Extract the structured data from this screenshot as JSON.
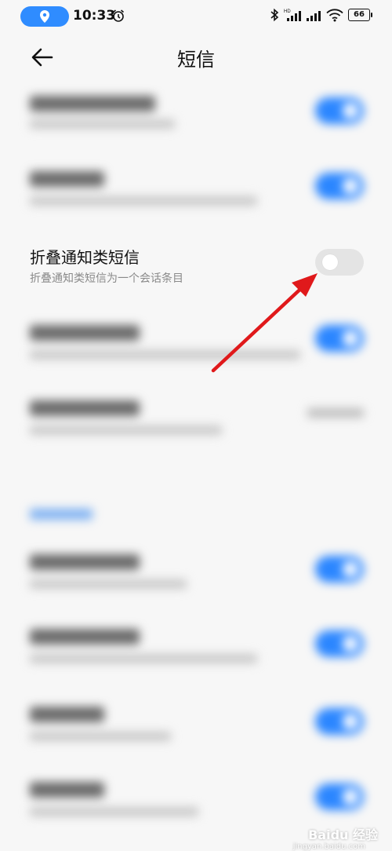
{
  "status_bar": {
    "time": "10:33",
    "battery": "66",
    "accent": "#2f8cff"
  },
  "header": {
    "title": "短信"
  },
  "rows": [
    {
      "title": "",
      "subtitle": "",
      "state": "on",
      "blurred": true
    },
    {
      "title": "",
      "subtitle": "",
      "state": "on",
      "blurred": true
    },
    {
      "title": "折叠通知类短信",
      "subtitle": "折叠通知类短信为一个会话条目",
      "state": "off",
      "blurred": false
    },
    {
      "title": "",
      "subtitle": "",
      "state": "on",
      "blurred": true
    },
    {
      "title": "",
      "subtitle": "",
      "value": "",
      "blurred": true
    },
    {
      "title": "",
      "subtitle": "",
      "state": "on",
      "blurred": true
    },
    {
      "title": "",
      "subtitle": "",
      "state": "on",
      "blurred": true
    },
    {
      "title": "",
      "subtitle": "",
      "state": "on",
      "blurred": true
    },
    {
      "title": "",
      "subtitle": "",
      "state": "on",
      "blurred": true
    }
  ],
  "colors": {
    "toggle_on": "#2b86ff",
    "toggle_off": "#e4e4e4",
    "arrow": "#e0191b"
  },
  "watermark": {
    "text": "Baidu 经验",
    "url": "jingyan.baidu.com"
  }
}
